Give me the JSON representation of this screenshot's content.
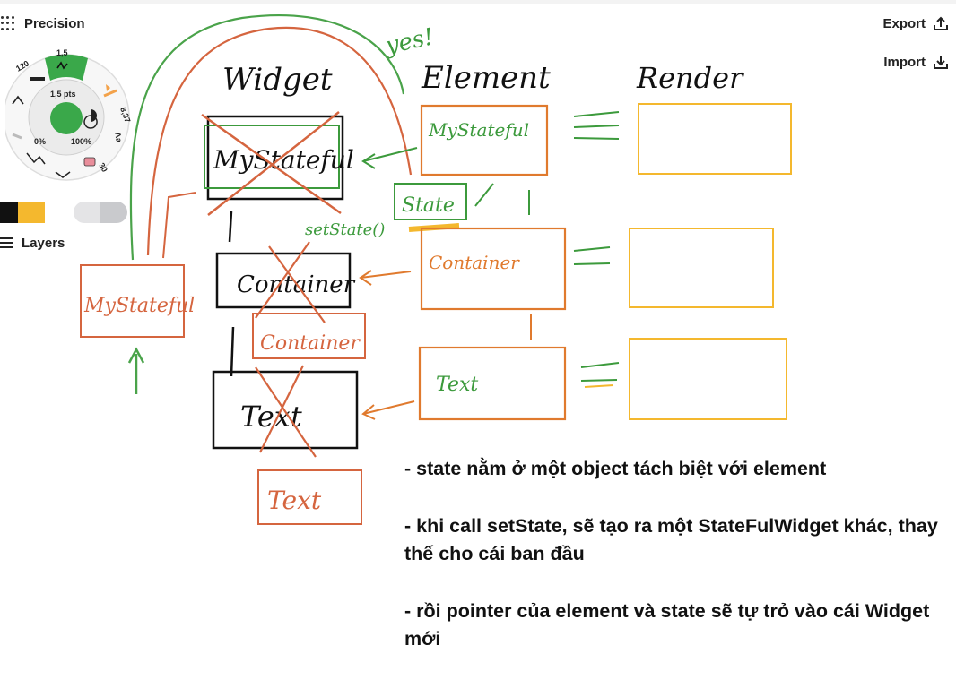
{
  "toolbar": {
    "precision_label": "Precision",
    "layers_label": "Layers",
    "export_label": "Export",
    "import_label": "Import"
  },
  "brush_wheel": {
    "size_top": "1,5",
    "size_left": "120",
    "size_pts": "1,5 pts",
    "right_value": "8,37",
    "opacity_left": "0%",
    "opacity_right": "100%",
    "font_label": "Aa",
    "bottom_right": "30",
    "active_color": "#3aa84a"
  },
  "swatches": [
    "#111111",
    "#f4b82e",
    "#ffffff",
    "#e2e2e4",
    "#c9cacd"
  ],
  "sketch": {
    "header_widget": "Widget",
    "header_element": "Element",
    "header_render": "Render",
    "annotation_yes": "yes!",
    "widget_mystateful": "MyStateful",
    "widget_container": "Container",
    "widget_text": "Text",
    "widget_container_new": "Container",
    "widget_text_new": "Text",
    "widget_mystateful_new": "MyStateful",
    "element_mystateful": "MyStateful",
    "element_state": "State",
    "element_setstate": "setState()",
    "element_container": "Container",
    "element_text": "Text"
  },
  "notes": [
    "- state nằm ở một object tách biệt với element",
    "- khi call setState, sẽ tạo ra một StateFulWidget khác, thay thế cho cái ban đầu",
    "- rồi pointer của element và state sẽ tự trỏ vào cái Widget mới"
  ]
}
